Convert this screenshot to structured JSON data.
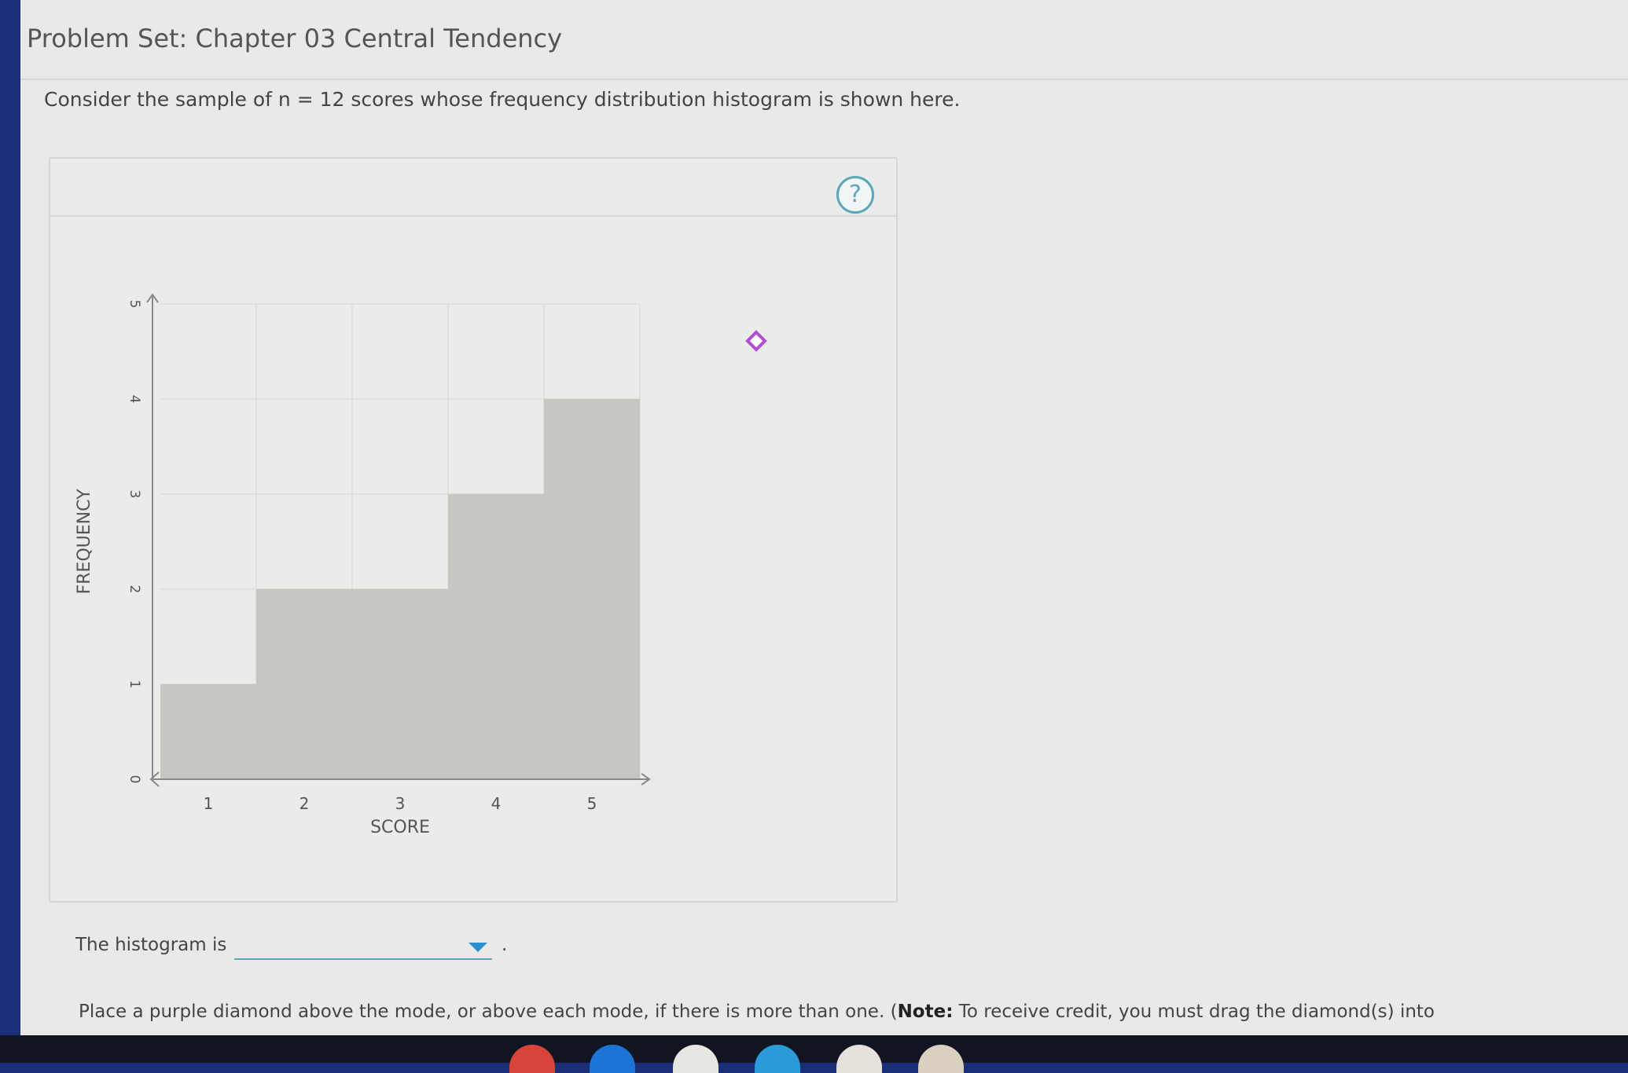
{
  "page": {
    "title": "Problem Set: Chapter 03 Central Tendency",
    "question": "Consider the sample of n = 12 scores whose frequency distribution histogram is shown here.",
    "answer_label": "The histogram is",
    "answer_dropdown_value": "",
    "answer_period": ".",
    "instructions_pre": "Place a purple diamond above the mode, or above each mode, if there is more than one. (",
    "instructions_note": "Note:",
    "instructions_post": " To receive credit, you must drag the diamond(s) into"
  },
  "graph": {
    "help_label": "?",
    "diamond_color": "#b04fd0"
  },
  "chart_data": {
    "type": "bar",
    "categories": [
      "1",
      "2",
      "3",
      "4",
      "5"
    ],
    "values": [
      1,
      2,
      2,
      3,
      4
    ],
    "xlabel": "SCORE",
    "ylabel": "FREQUENCY",
    "yticks": [
      "0",
      "1",
      "2",
      "3",
      "4",
      "5"
    ],
    "ylim": [
      0,
      5
    ],
    "grid": true,
    "bar_color": "#c6c6c2"
  }
}
